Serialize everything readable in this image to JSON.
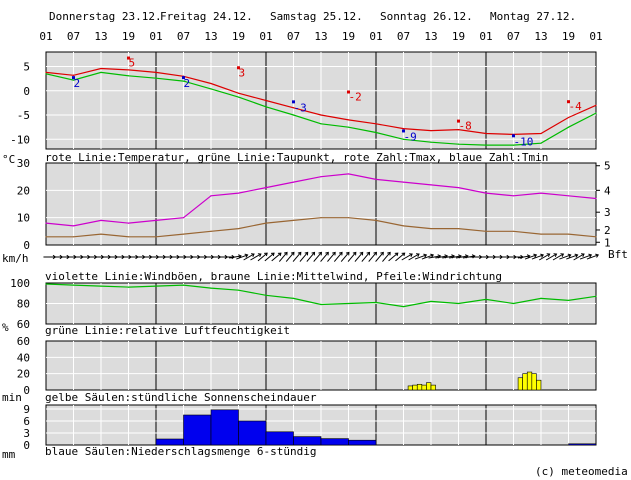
{
  "days": [
    "Donnerstag 23.12.",
    "Freitag 24.12.",
    "Samstag 25.12.",
    "Sonntag 26.12.",
    "Montag 27.12."
  ],
  "hour_ticks": [
    "01",
    "07",
    "13",
    "19",
    "01",
    "07",
    "13",
    "19",
    "01",
    "07",
    "13",
    "19",
    "01",
    "07",
    "13",
    "19",
    "01",
    "07",
    "13",
    "19",
    "01"
  ],
  "copyright": "(c) meteomedia",
  "colors": {
    "panel": "#dcdcdc",
    "grid": "#ffffff",
    "day_line": "#000000",
    "temp": "#dd0000",
    "dew": "#00bb00",
    "gust": "#cc00cc",
    "mean_wind": "#996633",
    "humidity": "#00bb00",
    "sun": "#ffff00",
    "precip": "#0000ee"
  },
  "chart_data": [
    {
      "type": "line",
      "panel": "temperature",
      "unit_label": "°C",
      "caption": "rote Linie:Temperatur, grüne Linie:Taupunkt, rote Zahl:Tmax, blaue Zahl:Tmin",
      "ylim": [
        -12,
        8
      ],
      "yticks": [
        "5",
        "0",
        "-5",
        "-10"
      ],
      "ytick_values": [
        5,
        0,
        -5,
        -10
      ],
      "x_hours": [
        0,
        6,
        12,
        18,
        24,
        30,
        36,
        42,
        48,
        54,
        60,
        66,
        72,
        78,
        84,
        90,
        96,
        102,
        108,
        114,
        120
      ],
      "series": [
        {
          "name": "Temperatur",
          "color": "#dd0000",
          "values": [
            3.8,
            3.2,
            4.6,
            4.3,
            3.8,
            3.0,
            1.5,
            -0.5,
            -2.0,
            -3.5,
            -5.0,
            -6.0,
            -6.8,
            -7.8,
            -8.2,
            -8.0,
            -8.8,
            -9.0,
            -8.8,
            -5.5,
            -3.0
          ]
        },
        {
          "name": "Taupunkt",
          "color": "#00bb00",
          "values": [
            3.5,
            2.2,
            3.8,
            3.1,
            2.6,
            2.0,
            0.4,
            -1.3,
            -3.3,
            -5.0,
            -6.8,
            -7.5,
            -8.6,
            -10.0,
            -10.6,
            -11.0,
            -11.2,
            -11.2,
            -10.8,
            -7.5,
            -4.6
          ]
        }
      ],
      "tmax": [
        {
          "hour": 18,
          "value": "5"
        },
        {
          "hour": 42,
          "value": "3"
        },
        {
          "hour": 66,
          "value": "-2"
        },
        {
          "hour": 90,
          "value": "-8"
        },
        {
          "hour": 114,
          "value": "-4"
        }
      ],
      "tmin": [
        {
          "hour": 6,
          "value": "2"
        },
        {
          "hour": 30,
          "value": "2"
        },
        {
          "hour": 54,
          "value": "-3"
        },
        {
          "hour": 78,
          "value": "-9"
        },
        {
          "hour": 102,
          "value": "-10"
        }
      ]
    },
    {
      "type": "line",
      "panel": "wind",
      "unit_label": "km/h",
      "right_unit_label": "Bft",
      "caption": "violette Linie:Windböen, braune Linie:Mittelwind, Pfeile:Windrichtung",
      "ylim": [
        0,
        30
      ],
      "yticks": [
        "30",
        "20",
        "10",
        "0"
      ],
      "ytick_values": [
        30,
        20,
        10,
        0
      ],
      "right_ticks": [
        {
          "label": "5",
          "value": 29
        },
        {
          "label": "4",
          "value": 20
        },
        {
          "label": "3",
          "value": 12
        },
        {
          "label": "2",
          "value": 5.5
        },
        {
          "label": "1",
          "value": 1
        }
      ],
      "x_hours": [
        0,
        6,
        12,
        18,
        24,
        30,
        36,
        42,
        48,
        54,
        60,
        66,
        72,
        78,
        84,
        90,
        96,
        102,
        108,
        114,
        120
      ],
      "series": [
        {
          "name": "Windböen",
          "color": "#cc00cc",
          "values": [
            8,
            7,
            9,
            8,
            9,
            10,
            18,
            19,
            21,
            23,
            25,
            26,
            24,
            23,
            22,
            21,
            19,
            18,
            19,
            18,
            17
          ]
        },
        {
          "name": "Mittelwind",
          "color": "#996633",
          "values": [
            3,
            3,
            4,
            3,
            3,
            4,
            5,
            6,
            8,
            9,
            10,
            10,
            9,
            7,
            6,
            6,
            5,
            5,
            4,
            4,
            3
          ]
        }
      ],
      "wind_directions_deg": [
        270,
        270,
        270,
        270,
        270,
        270,
        270,
        270,
        270,
        270,
        270,
        270,
        270,
        270,
        270,
        270,
        270,
        270,
        270,
        270,
        270,
        270,
        270,
        270,
        270,
        270,
        270,
        260,
        250,
        240,
        240,
        230,
        230,
        230,
        220,
        220,
        220,
        220,
        220,
        220,
        220,
        220,
        220,
        220,
        220,
        220,
        220,
        220,
        220,
        220,
        230,
        230,
        240,
        240,
        250,
        250,
        260,
        260,
        260,
        260,
        260,
        260,
        270,
        270,
        270,
        270,
        270,
        270,
        270,
        260,
        250,
        250,
        240,
        240,
        240,
        250,
        250,
        240,
        250,
        250
      ]
    },
    {
      "type": "line",
      "panel": "humidity",
      "unit_label": "%",
      "caption": "grüne Linie:relative Luftfeuchtigkeit",
      "ylim": [
        60,
        100
      ],
      "yticks": [
        "100",
        "80",
        "60"
      ],
      "ytick_values": [
        100,
        80,
        60
      ],
      "x_hours": [
        0,
        6,
        12,
        18,
        24,
        30,
        36,
        42,
        48,
        54,
        60,
        66,
        72,
        78,
        84,
        90,
        96,
        102,
        108,
        114,
        120
      ],
      "series": [
        {
          "name": "relative Luftfeuchtigkeit",
          "color": "#00bb00",
          "values": [
            99,
            98,
            97,
            96,
            97,
            98,
            95,
            93,
            88,
            85,
            79,
            80,
            81,
            77,
            82,
            80,
            84,
            80,
            85,
            83,
            87
          ]
        }
      ]
    },
    {
      "type": "bar",
      "panel": "sunshine",
      "unit_label": "min",
      "caption": "gelbe Säulen:stündliche Sonnenscheindauer",
      "ylim": [
        0,
        60
      ],
      "yticks": [
        "60",
        "40",
        "20",
        "0"
      ],
      "ytick_values": [
        60,
        40,
        20,
        0
      ],
      "bars": [
        {
          "hour": 79,
          "value": 5
        },
        {
          "hour": 80,
          "value": 6
        },
        {
          "hour": 81,
          "value": 7
        },
        {
          "hour": 82,
          "value": 6
        },
        {
          "hour": 83,
          "value": 9
        },
        {
          "hour": 84,
          "value": 6
        },
        {
          "hour": 103,
          "value": 15
        },
        {
          "hour": 104,
          "value": 20
        },
        {
          "hour": 105,
          "value": 22
        },
        {
          "hour": 106,
          "value": 20
        },
        {
          "hour": 107,
          "value": 12
        }
      ]
    },
    {
      "type": "bar",
      "panel": "precipitation",
      "unit_label": "mm",
      "caption": "blaue Säulen:Niederschlagsmenge 6-stündig",
      "ylim": [
        0,
        10
      ],
      "yticks": [
        "9",
        "6",
        "3",
        "0"
      ],
      "ytick_values": [
        9,
        6,
        3,
        0
      ],
      "bar_hours": 6,
      "bars": [
        {
          "hour": 24,
          "value": 1.5
        },
        {
          "hour": 30,
          "value": 7.5
        },
        {
          "hour": 36,
          "value": 8.8
        },
        {
          "hour": 42,
          "value": 6.0
        },
        {
          "hour": 48,
          "value": 3.3
        },
        {
          "hour": 54,
          "value": 2.1
        },
        {
          "hour": 60,
          "value": 1.6
        },
        {
          "hour": 66,
          "value": 1.2
        },
        {
          "hour": 114,
          "value": 0.3
        }
      ]
    }
  ]
}
